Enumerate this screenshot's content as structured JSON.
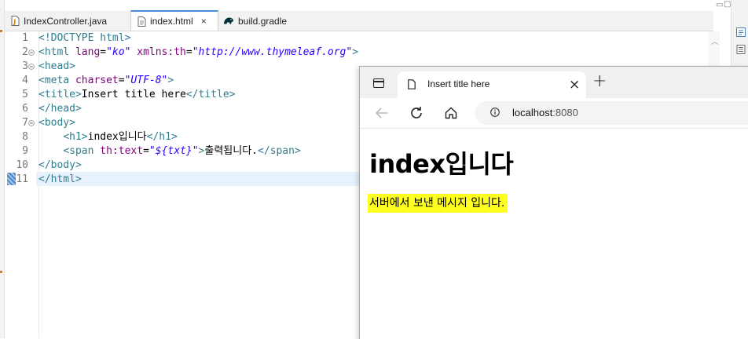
{
  "editor": {
    "tabs": [
      {
        "label": "IndexController.java",
        "icon": "java-file-icon",
        "active": false
      },
      {
        "label": "index.html",
        "icon": "html-file-icon",
        "active": true,
        "close": "×"
      },
      {
        "label": "build.gradle",
        "icon": "gradle-elephant-icon",
        "active": false
      }
    ],
    "line_numbers": [
      "1",
      "2",
      "3",
      "4",
      "5",
      "6",
      "7",
      "8",
      "9",
      "10",
      "11"
    ],
    "lines": [
      [
        {
          "t": "tag",
          "v": "<!DOCTYPE html>"
        }
      ],
      [
        {
          "t": "tag",
          "v": "<html "
        },
        {
          "t": "attr",
          "v": "lang"
        },
        {
          "t": "txt",
          "v": "="
        },
        {
          "t": "val",
          "v": "\"ko\""
        },
        {
          "t": "txt",
          "v": " "
        },
        {
          "t": "attr",
          "v": "xmlns:th"
        },
        {
          "t": "txt",
          "v": "="
        },
        {
          "t": "val",
          "v": "\"http://www.thymeleaf.org\""
        },
        {
          "t": "tag",
          "v": ">"
        }
      ],
      [
        {
          "t": "tag",
          "v": "<head>"
        }
      ],
      [
        {
          "t": "tag",
          "v": "<meta "
        },
        {
          "t": "attr",
          "v": "charset"
        },
        {
          "t": "txt",
          "v": "="
        },
        {
          "t": "val",
          "v": "\"UTF-8\""
        },
        {
          "t": "tag",
          "v": ">"
        }
      ],
      [
        {
          "t": "tag",
          "v": "<title>"
        },
        {
          "t": "txt",
          "v": "Insert title here"
        },
        {
          "t": "tag",
          "v": "</title>"
        }
      ],
      [
        {
          "t": "tag",
          "v": "</head>"
        }
      ],
      [
        {
          "t": "tag",
          "v": "<body>"
        }
      ],
      [
        {
          "t": "txt",
          "v": "    "
        },
        {
          "t": "tag",
          "v": "<h1>"
        },
        {
          "t": "txt",
          "v": "index입니다"
        },
        {
          "t": "tag",
          "v": "</h1>"
        }
      ],
      [
        {
          "t": "txt",
          "v": "    "
        },
        {
          "t": "tag",
          "v": "<span "
        },
        {
          "t": "attr",
          "v": "th:text"
        },
        {
          "t": "txt",
          "v": "="
        },
        {
          "t": "val",
          "v": "\"${txt}\""
        },
        {
          "t": "tag",
          "v": ">"
        },
        {
          "t": "txt",
          "v": "출력됩니다."
        },
        {
          "t": "tag",
          "v": "</span>"
        }
      ],
      [
        {
          "t": "tag",
          "v": "</body>"
        }
      ],
      [
        {
          "t": "tag",
          "v": "</html>"
        }
      ]
    ],
    "fold_lines": [
      2,
      3,
      7
    ],
    "current_line": 11
  },
  "browser": {
    "tab_title": "Insert title here",
    "tab_close": "×",
    "new_tab": "+",
    "url_host": "localhost",
    "url_port": ":8080",
    "heading": "index입니다",
    "message": "서버에서 보낸 메시지 입니다."
  },
  "colors": {
    "tag": "#2f7d8f",
    "attr": "#7f007f",
    "value": "#2a00ff",
    "highlight": "#ffff20",
    "current_line": "#e8f2fe"
  }
}
